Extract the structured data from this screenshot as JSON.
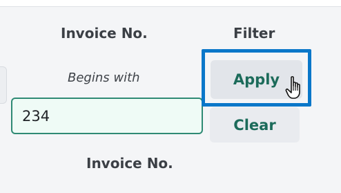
{
  "table": {
    "column_header": "Invoice No.",
    "filter_header": "Filter",
    "footer_label": "Invoice No."
  },
  "filter": {
    "mode_label": "Begins with",
    "value": "234",
    "apply_label": "Apply",
    "clear_label": "Clear"
  },
  "colors": {
    "accent": "#1c6b5a",
    "focus_ring": "#0a77c9",
    "input_border": "#2f8a74"
  },
  "icons": {
    "cursor": "hand-pointer-icon"
  }
}
